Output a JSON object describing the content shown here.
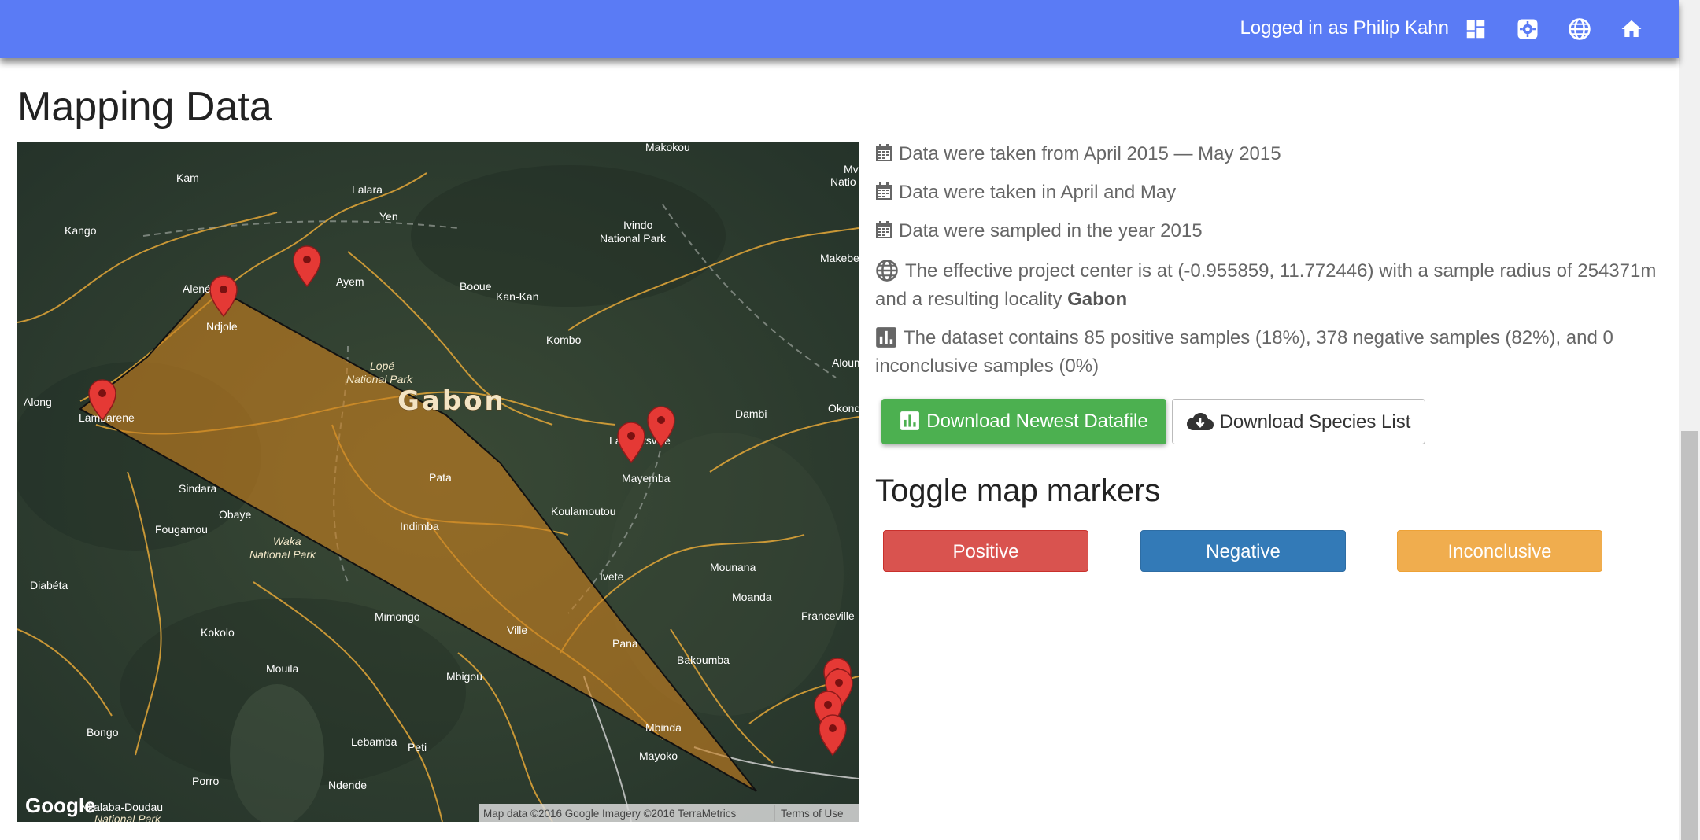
{
  "header": {
    "user_text": "Logged in as Philip Kahn",
    "bg_color": "#5a7bf5",
    "icons": [
      "dashboard-icon",
      "settings-icon",
      "globe-icon",
      "home-icon"
    ]
  },
  "page": {
    "title": "Mapping Data"
  },
  "map": {
    "region_label": "Gabon",
    "places": [
      "Makokou",
      "Kam",
      "Lalara",
      "Kango",
      "Yen",
      "Ivindo",
      "National Park",
      "Makebe",
      "Alené",
      "Ndjole",
      "Ayem",
      "Booue",
      "Kan-Kan",
      "Kombo",
      "Lopé",
      "National Park",
      "Aloum",
      "Along",
      "Lambarene",
      "Lastoursville",
      "Dambi",
      "Okond",
      "Mayemba",
      "Pata",
      "Sindara",
      "Obaye",
      "Fougamou",
      "Koulamoutou",
      "Indimba",
      "Waka",
      "National Park",
      "Ivete",
      "Mounana",
      "Moanda",
      "Diabéta",
      "Mimongo",
      "Ville",
      "Franceville",
      "Kokolo",
      "Pana",
      "Bakoumba",
      "Mouila",
      "Mbigou",
      "Mbinda",
      "Bongo",
      "Lebamba",
      "Peti",
      "Mayoko",
      "Porro",
      "Ndende",
      "Nkalaba-Doudau",
      "National Park",
      "Natio",
      "Mv"
    ],
    "attribution": "Map data ©2016 Google Imagery ©2016 TerraMetrics",
    "terms": "Terms of Use",
    "logo": "Google",
    "polygon_color": "#c87f1e"
  },
  "info": {
    "date_range": "Data were taken from April 2015 — May 2015",
    "months": "Data were taken in April and May",
    "year": "Data were sampled in the year 2015",
    "center_prefix": "The effective project center is at (-0.955859, 11.772446) with a sample radius of 254371m and a resulting locality ",
    "locality": "Gabon",
    "dataset": "The dataset contains 85 positive samples (18%), 378 negative samples (82%), and 0 inconclusive samples (0%)"
  },
  "buttons": {
    "download_data": "Download Newest Datafile",
    "download_species": "Download Species List"
  },
  "toggle": {
    "title": "Toggle map markers",
    "positive": "Positive",
    "negative": "Negative",
    "inconclusive": "Inconclusive"
  }
}
